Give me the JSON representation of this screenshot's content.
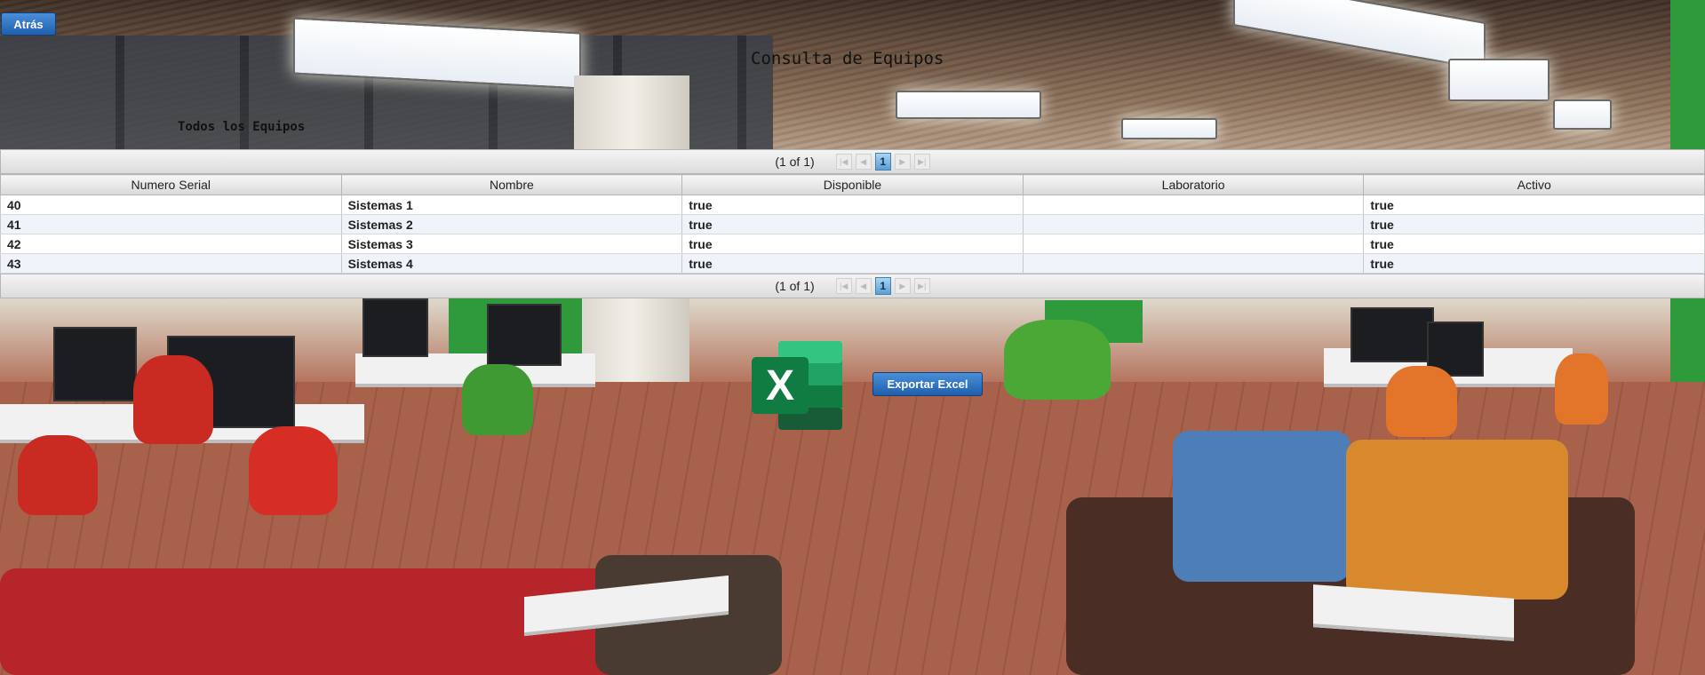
{
  "nav": {
    "back_label": "Atrás"
  },
  "page": {
    "title": "Consulta de Equipos",
    "subtitle": "Todos los Equipos"
  },
  "paginator": {
    "report": "(1 of 1)",
    "current_page": "1"
  },
  "table": {
    "columns": [
      "Numero Serial",
      "Nombre",
      "Disponible",
      "Laboratorio",
      "Activo"
    ],
    "rows": [
      [
        "40",
        "Sistemas 1",
        "true",
        "",
        "true"
      ],
      [
        "41",
        "Sistemas 2",
        "true",
        "",
        "true"
      ],
      [
        "42",
        "Sistemas 3",
        "true",
        "",
        "true"
      ],
      [
        "43",
        "Sistemas 4",
        "true",
        "",
        "true"
      ]
    ]
  },
  "export": {
    "label": "Exportar Excel",
    "icon": "excel-icon"
  },
  "colors": {
    "button_blue": "#1f5fae",
    "row_alt": "#eef4fa",
    "excel_green": "#1f7a3f"
  }
}
